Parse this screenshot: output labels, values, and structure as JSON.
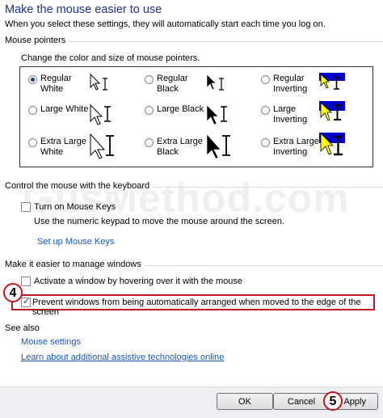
{
  "header": {
    "title": "Make the mouse easier to use",
    "intro": "When you select these settings, they will automatically start each time you log on."
  },
  "mouse_pointers": {
    "heading": "Mouse pointers",
    "description": "Change the color and size of mouse pointers.",
    "options": [
      {
        "line1": "Regular",
        "line2": "White",
        "checked": true
      },
      {
        "line1": "Regular",
        "line2": "Black",
        "checked": false
      },
      {
        "line1": "Regular",
        "line2": "Inverting",
        "checked": false
      },
      {
        "line1": "Large White",
        "line2": "",
        "checked": false
      },
      {
        "line1": "Large Black",
        "line2": "",
        "checked": false
      },
      {
        "line1": "Large",
        "line2": "Inverting",
        "checked": false
      },
      {
        "line1": "Extra Large",
        "line2": "White",
        "checked": false
      },
      {
        "line1": "Extra Large",
        "line2": "Black",
        "checked": false
      },
      {
        "line1": "Extra Large",
        "line2": "Inverting",
        "checked": false
      }
    ]
  },
  "keyboard": {
    "heading": "Control the mouse with the keyboard",
    "mouse_keys_label": "Turn on Mouse Keys",
    "mouse_keys_checked": false,
    "mouse_keys_desc": "Use the numeric keypad to move the mouse around the screen.",
    "setup_link": "Set up Mouse Keys"
  },
  "windows": {
    "heading": "Make it easier to manage windows",
    "hover_label": "Activate a window by hovering over it with the mouse",
    "hover_checked": false,
    "prevent_label": "Prevent windows from being automatically arranged when moved to the edge of the screen",
    "prevent_checked": true
  },
  "see_also": {
    "heading": "See also",
    "mouse_settings": "Mouse settings",
    "learn_more": "Learn about additional assistive technologies online"
  },
  "annotations": {
    "step4": "4",
    "step5": "5",
    "highlight_color": "#c4161c"
  },
  "watermark": "GusMethod.com",
  "buttons": {
    "ok": "OK",
    "cancel": "Cancel",
    "apply": "Apply"
  },
  "colors": {
    "title": "#1e3287",
    "link": "#1a58b6",
    "inverting_bg": "#0000c8",
    "inverting_fg": "#ffff00"
  }
}
